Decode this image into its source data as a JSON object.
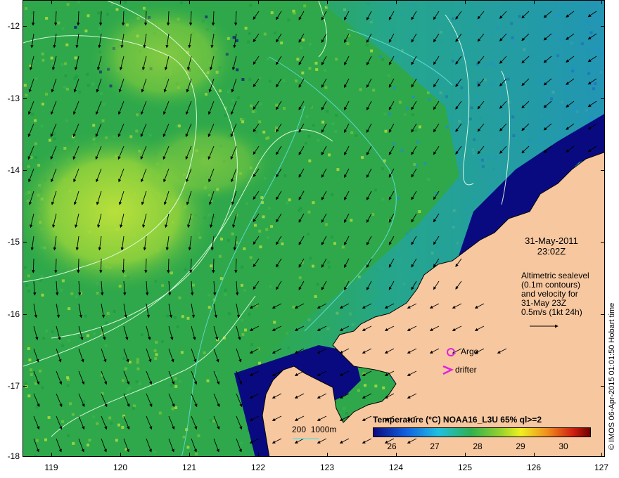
{
  "map": {
    "lat_labels": [
      "-12",
      "-13",
      "-14",
      "-15",
      "-16",
      "-17",
      "-18"
    ],
    "lon_labels": [
      "119",
      "120",
      "121",
      "122",
      "123",
      "124",
      "125",
      "126",
      "127"
    ],
    "lat_range": [
      -18,
      -11.65
    ],
    "lon_range": [
      118.6,
      127
    ],
    "date_line1": "31-May-2011",
    "date_line2": "23:02Z",
    "altimetry_lines": [
      "Altimetric sealevel",
      "(0.1m contours)",
      "and velocity for",
      "31-May 23Z",
      "0.5m/s (1kt 24h)"
    ],
    "argo_label": "Argo",
    "drifter_label": "drifter",
    "depth_legend": "200  1000m",
    "colorbar_title": "Temperature (°C) NOAA16_L3U 65% ql>=2",
    "colorbar_labels": [
      "26",
      "27",
      "28",
      "29",
      "30"
    ],
    "colorbar_range": [
      25.6,
      30.8
    ],
    "credit": "© IMOS 06-Apr-2015 01:01:50 Hobart time",
    "colors": {
      "ocean_warm": "#2ea84a",
      "ocean_cool": "#1f9fd8",
      "ocean_cold": "#0a0a80",
      "land": "#f7c79f",
      "argo": "#e020e0",
      "contour": "#e8ffe8",
      "isobath": "#66e0e0"
    },
    "argo_position": {
      "lon": 124.8,
      "lat": -16.53
    },
    "drifter_position": {
      "lon": 124.7,
      "lat": -16.8
    }
  }
}
